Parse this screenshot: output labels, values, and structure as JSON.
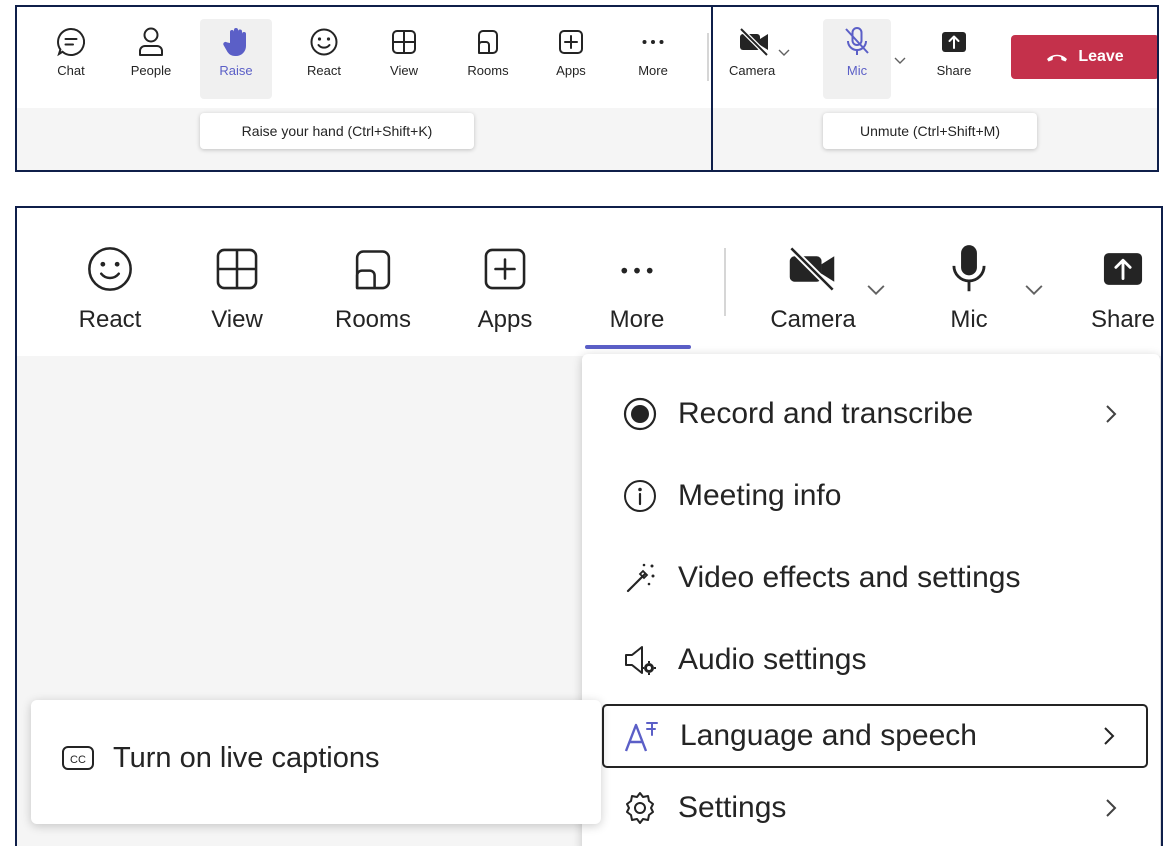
{
  "top_left_toolbar": {
    "buttons": [
      {
        "label": "Chat",
        "icon": "chat-icon"
      },
      {
        "label": "People",
        "icon": "person-icon"
      },
      {
        "label": "Raise",
        "icon": "raised-hand-icon"
      },
      {
        "label": "React",
        "icon": "smiley-icon"
      },
      {
        "label": "View",
        "icon": "grid-icon"
      },
      {
        "label": "Rooms",
        "icon": "rooms-icon"
      },
      {
        "label": "Apps",
        "icon": "add-app-icon"
      },
      {
        "label": "More",
        "icon": "more-icon"
      }
    ],
    "tooltip": "Raise your hand (Ctrl+Shift+K)"
  },
  "top_right_toolbar": {
    "camera_label": "Camera",
    "mic_label": "Mic",
    "share_label": "Share",
    "leave_label": "Leave",
    "tooltip": "Unmute (Ctrl+Shift+M)"
  },
  "zoomed_toolbar": {
    "react_label": "React",
    "view_label": "View",
    "rooms_label": "Rooms",
    "apps_label": "Apps",
    "more_label": "More",
    "camera_label": "Camera",
    "mic_label": "Mic",
    "share_label": "Share"
  },
  "more_menu": {
    "items": [
      {
        "label": "Record and transcribe",
        "icon": "record-icon",
        "submenu": true
      },
      {
        "label": "Meeting info",
        "icon": "info-icon",
        "submenu": false
      },
      {
        "label": "Video effects and settings",
        "icon": "magic-wand-icon",
        "submenu": false
      },
      {
        "label": "Audio settings",
        "icon": "speaker-settings-icon",
        "submenu": false
      },
      {
        "label": "Language and speech",
        "icon": "language-icon",
        "submenu": true,
        "focused": true
      },
      {
        "label": "Settings",
        "icon": "gear-icon",
        "submenu": true
      }
    ]
  },
  "captions_submenu": {
    "item_label": "Turn on live captions",
    "icon": "cc-icon"
  },
  "colors": {
    "accent": "#5b5fc7",
    "leave_red": "#c4314b",
    "panel_border": "#0f1f4a"
  }
}
